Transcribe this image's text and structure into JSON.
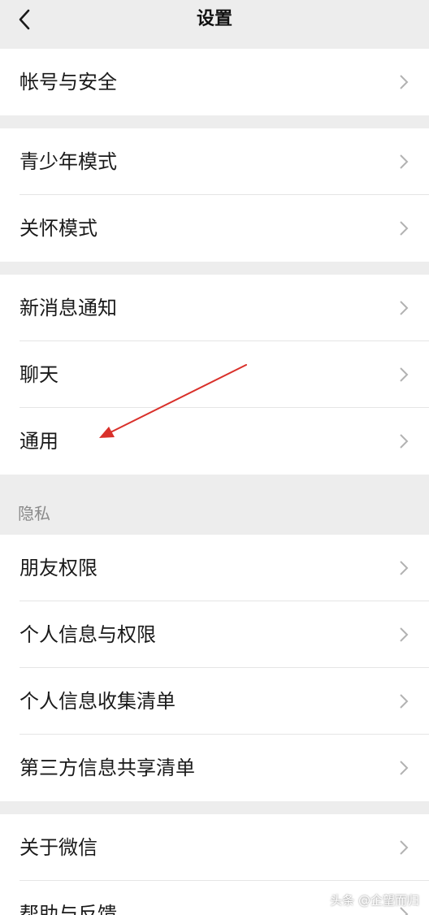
{
  "header": {
    "title": "设置",
    "back_icon": "chevron-left-icon"
  },
  "groups": [
    {
      "items": [
        {
          "label": "帐号与安全"
        }
      ]
    },
    {
      "items": [
        {
          "label": "青少年模式"
        },
        {
          "label": "关怀模式"
        }
      ]
    },
    {
      "items": [
        {
          "label": "新消息通知"
        },
        {
          "label": "聊天"
        },
        {
          "label": "通用"
        }
      ]
    },
    {
      "section_label": "隐私",
      "items": [
        {
          "label": "朋友权限"
        },
        {
          "label": "个人信息与权限"
        },
        {
          "label": "个人信息收集清单"
        },
        {
          "label": "第三方信息共享清单"
        }
      ]
    },
    {
      "items": [
        {
          "label": "关于微信"
        },
        {
          "label": "帮助与反馈"
        }
      ]
    }
  ],
  "annotation": {
    "type": "red-arrow",
    "color": "#d9302a",
    "points_to": "通用"
  },
  "watermark": "头条 @企望而归",
  "colors": {
    "background": "#ededed",
    "row_background": "#ffffff",
    "chevron": "#b2b2b2"
  }
}
